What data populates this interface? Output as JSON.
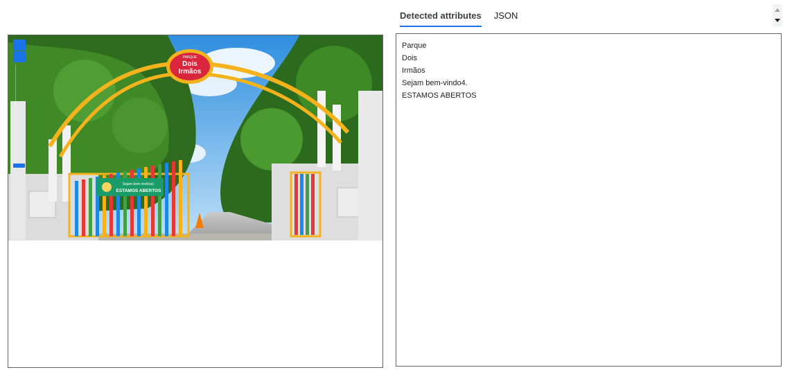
{
  "tabs": [
    {
      "label": "Detected attributes",
      "active": true
    },
    {
      "label": "JSON",
      "active": false
    }
  ],
  "detected_text": [
    "Parque",
    "Dois",
    "Irmãos",
    "Sejam bem-vindo4.",
    "ESTAMOS ABERTOS"
  ],
  "photo": {
    "sign_logo_top": "PARQUE",
    "sign_logo_line1": "Dois",
    "sign_logo_line2": "Irmãos",
    "gate_banner_line1": "Sejam bem-vindo(a).",
    "gate_banner_line2": "ESTAMOS ABERTOS"
  },
  "colors": {
    "accent": "#1a73e8",
    "arch": "#f4b21d",
    "sky": "#4aa3e8"
  },
  "icons": [
    "zoom-in-icon",
    "zoom-out-icon",
    "zoom-slider-icon",
    "scroll-up-icon",
    "scroll-down-icon"
  ]
}
